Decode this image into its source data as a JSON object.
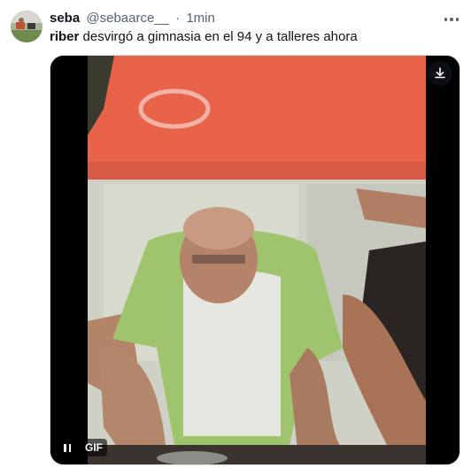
{
  "tweet": {
    "display_name": "seba",
    "handle": "@sebaarce__",
    "separator": "·",
    "timestamp": "1min",
    "text_mention": "riber",
    "text_body": " desvirgó a gimnasia en el 94 y a talleres ahora",
    "more_icon": "more-horizontal-icon"
  },
  "media": {
    "badge_label": "GIF",
    "download_icon": "download-icon",
    "pause_icon": "pause-icon",
    "accent": "#e8634a"
  }
}
